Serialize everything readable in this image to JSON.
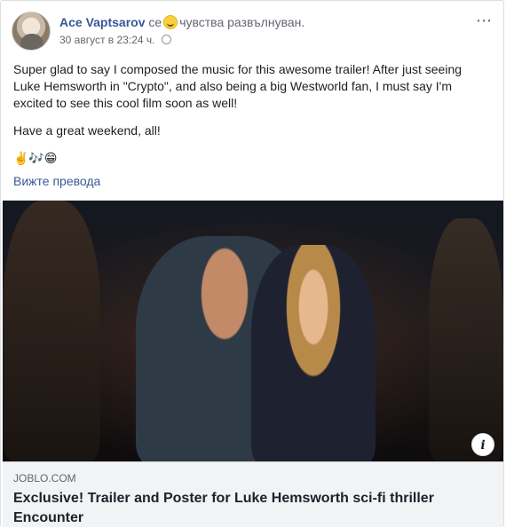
{
  "post": {
    "author": "Ace Vaptsarov",
    "feeling_verb": "се",
    "feeling_text": "чувства развълнуван.",
    "timestamp": "30 август в 23:24 ч.",
    "more_icon": "⋯",
    "paragraphs": [
      "Super glad to say I composed the music for this awesome trailer! After just seeing Luke Hemsworth in \"Crypto\", and also being a big Westworld fan, I must say I'm excited to see this cool film soon as well!",
      "Have a great weekend, all!"
    ],
    "emojis": "✌️🎶😁",
    "see_translation": "Вижте превода"
  },
  "link": {
    "domain": "JOBLO.COM",
    "title": "Exclusive! Trailer and Poster for Luke Hemsworth sci-fi thriller Encounter",
    "info_icon": "i"
  },
  "icons": {
    "feeling": "grinning-face-icon",
    "privacy": "globe-icon",
    "more": "more-options-icon",
    "info": "info-icon"
  },
  "colors": {
    "author": "#385898",
    "link": "#385898",
    "meta": "#616770",
    "link_card_bg": "#f2f3f5"
  }
}
